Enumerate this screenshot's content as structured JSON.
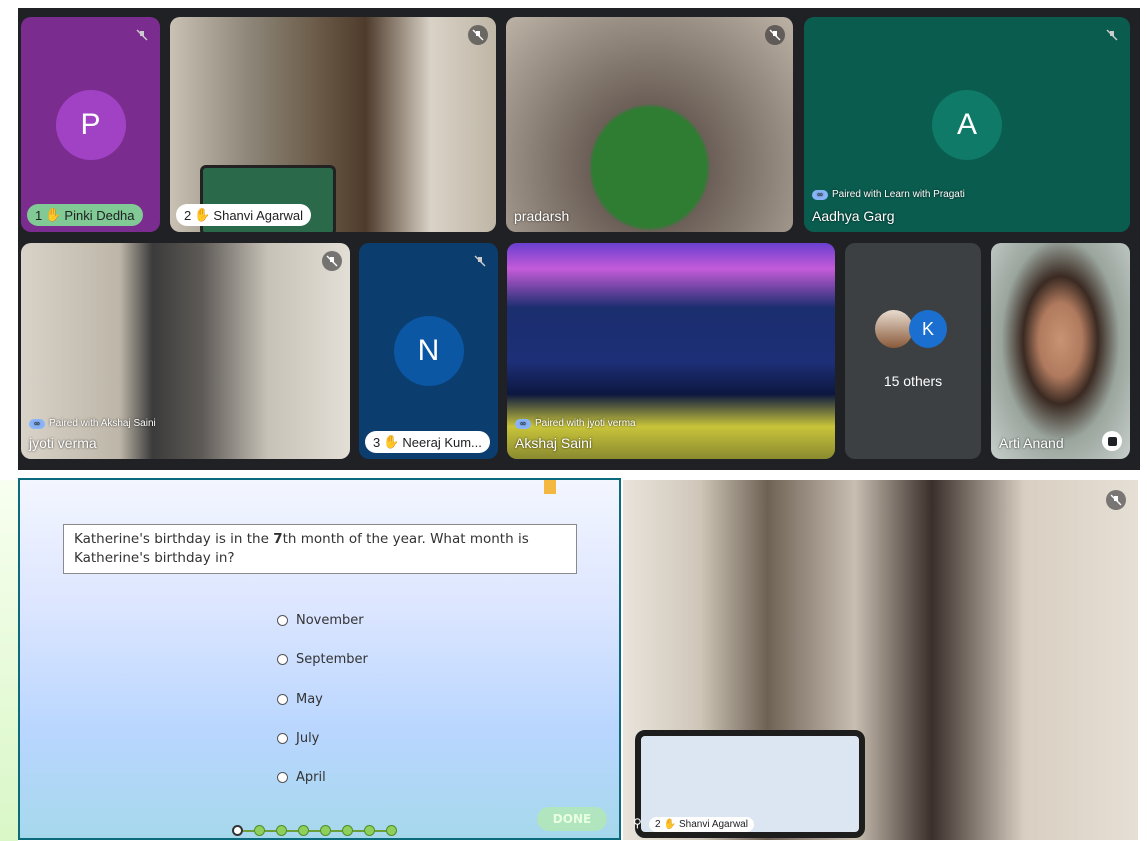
{
  "meeting": {
    "tiles": [
      {
        "name": "Pinki Dedha",
        "hand_number": "1",
        "avatar_letter": "P",
        "avatar_color": "#a142c5",
        "bg_color": "#7b2c8f",
        "muted": true
      },
      {
        "name": "Shanvi Agarwal",
        "hand_number": "2",
        "muted": true
      },
      {
        "name": "pradarsh",
        "muted": true
      },
      {
        "name": "Aadhya Garg",
        "avatar_letter": "A",
        "avatar_color": "#0f7a67",
        "bg_color": "#0a5c4f",
        "paired_with": "Paired with Learn with Pragati",
        "muted": true
      },
      {
        "name": "jyoti verma",
        "paired_with": "Paired with Akshaj Saini",
        "muted": true
      },
      {
        "name": "Neeraj Kum...",
        "hand_number": "3",
        "avatar_letter": "N",
        "avatar_color": "#0b57a4",
        "bg_color": "#0b3e6e",
        "muted": true
      },
      {
        "name": "Akshaj Saini",
        "paired_with": "Paired with jyoti verma"
      },
      {
        "others_label": "15 others",
        "others_letter": "K",
        "others_color": "#1a6fd0"
      },
      {
        "name": "Arti Anand"
      }
    ],
    "hand_icon": "raised-hand-icon",
    "mute_icon": "mic-off-icon"
  },
  "quiz": {
    "question_before": "Katherine's birthday is in the ",
    "question_bold": "7",
    "question_after": "th month of the year. What month is Katherine's birthday in?",
    "options": [
      "November",
      "September",
      "May",
      "July",
      "April"
    ],
    "done_label": "DONE",
    "progress_total": 8,
    "progress_current": 1
  },
  "spotlight": {
    "name": "Shanvi Agarwal",
    "hand_number": "2"
  }
}
